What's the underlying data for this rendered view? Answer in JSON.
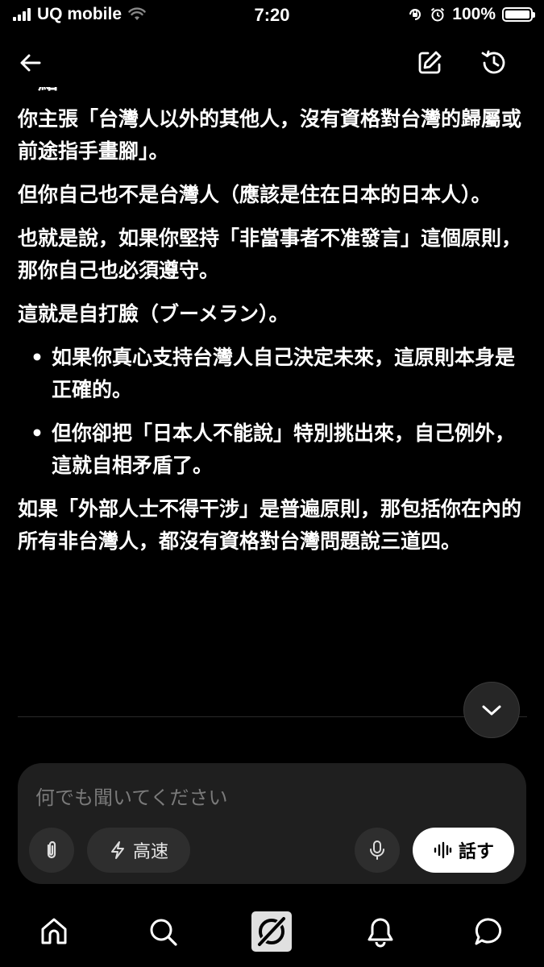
{
  "status_bar": {
    "carrier": "UQ mobile",
    "time": "7:20",
    "battery": "100%",
    "battery_level": 1.0
  },
  "nav": {
    "back_icon": "arrow-left-icon",
    "edit_icon": "edit-note-icon",
    "history_icon": "history-icon"
  },
  "content": {
    "cut_line": "一點",
    "paragraph_1": "你主張「台灣人以外的其他人，沒有資格對台灣的歸屬或前途指手畫腳」。",
    "paragraph_2": "但你自己也不是台灣人（應該是住在日本的日本人）。",
    "paragraph_3": "也就是說，如果你堅持「非當事者不准發言」這個原則，那你自己也必須遵守。",
    "paragraph_4": "這就是自打臉（ブーメラン）。",
    "bullets": [
      "如果你真心支持台灣人自己決定未來，這原則本身是正確的。",
      "但你卻把「日本人不能說」特別挑出來，自己例外，這就自相矛盾了。"
    ],
    "paragraph_5": "如果「外部人士不得干涉」是普遍原則，那包括你在內的所有非台灣人，都沒有資格對台灣問題說三道四。"
  },
  "composer": {
    "placeholder": "何でも聞いてください",
    "speed_label": "高速",
    "talk_label": "話す"
  },
  "tabs": [
    "home-icon",
    "search-icon",
    "grok-icon",
    "bell-icon",
    "chat-icon"
  ],
  "colors": {
    "background": "#000000",
    "panel": "#1f1f1f",
    "pill": "#2e2e2e",
    "text": "#ffffff",
    "placeholder": "#7a7a7a"
  }
}
